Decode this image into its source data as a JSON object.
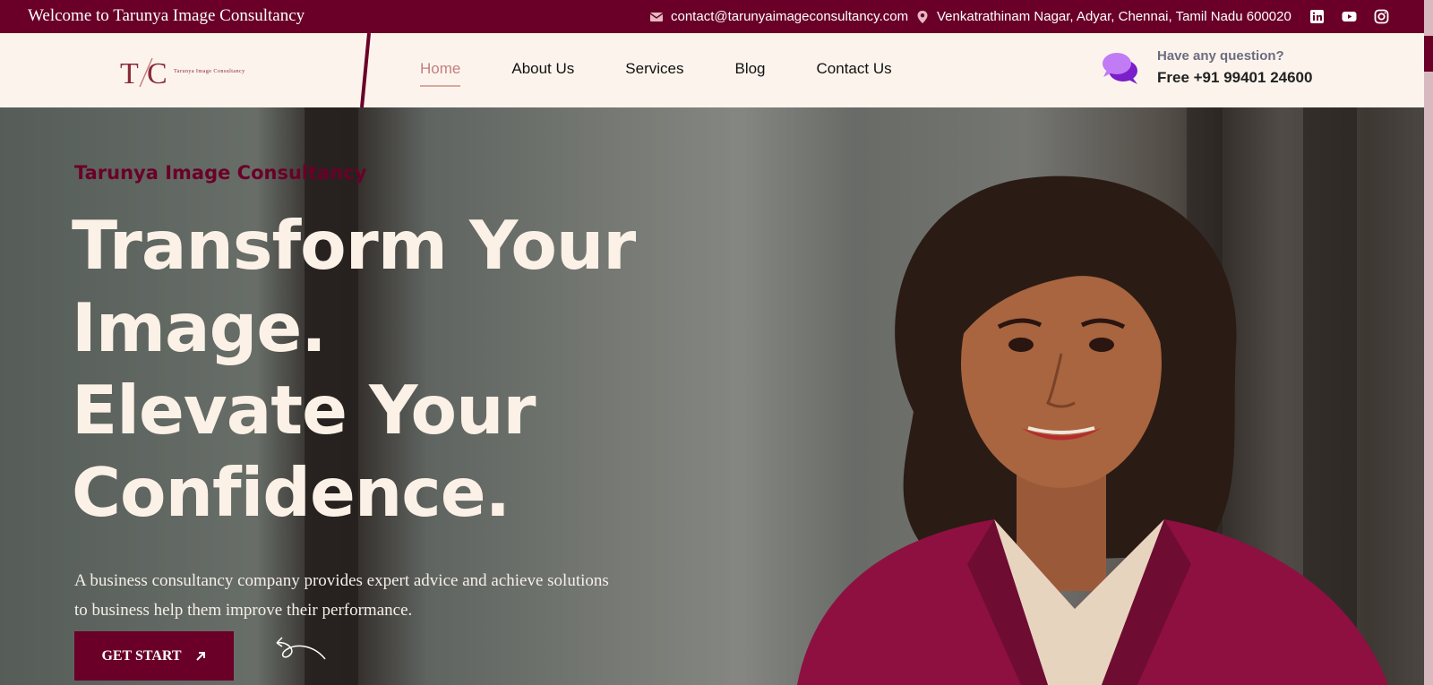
{
  "topbar": {
    "welcome": "Welcome to Tarunya Image Consultancy",
    "email": "contact@tarunyaimageconsultancy.com",
    "address": "Venkatrathinam Nagar, Adyar, Chennai, Tamil Nadu 600020",
    "socials": [
      "linkedin-icon",
      "youtube-icon",
      "instagram-icon"
    ]
  },
  "logo": {
    "text": "Tarunya Image Consultancy"
  },
  "nav": {
    "items": [
      {
        "label": "Home",
        "active": true
      },
      {
        "label": "About Us",
        "active": false
      },
      {
        "label": "Services",
        "active": false
      },
      {
        "label": "Blog",
        "active": false
      },
      {
        "label": "Contact Us",
        "active": false
      }
    ]
  },
  "question": {
    "label": "Have any question?",
    "phone": "Free +91 99401 24600"
  },
  "hero": {
    "kicker": "Tarunya Image Consultancy",
    "headline": [
      "Transform Your",
      "Image.",
      "Elevate Your",
      "Confidence."
    ],
    "description_line1": "A business consultancy company provides expert advice and achieve solutions",
    "description_line2": "to business help them improve their performance.",
    "cta": "GET START"
  },
  "colors": {
    "brand": "#6a0028",
    "cream": "#fcf4ec",
    "nav_active": "#c27f7f",
    "chat_icon": "#a64bf4"
  }
}
